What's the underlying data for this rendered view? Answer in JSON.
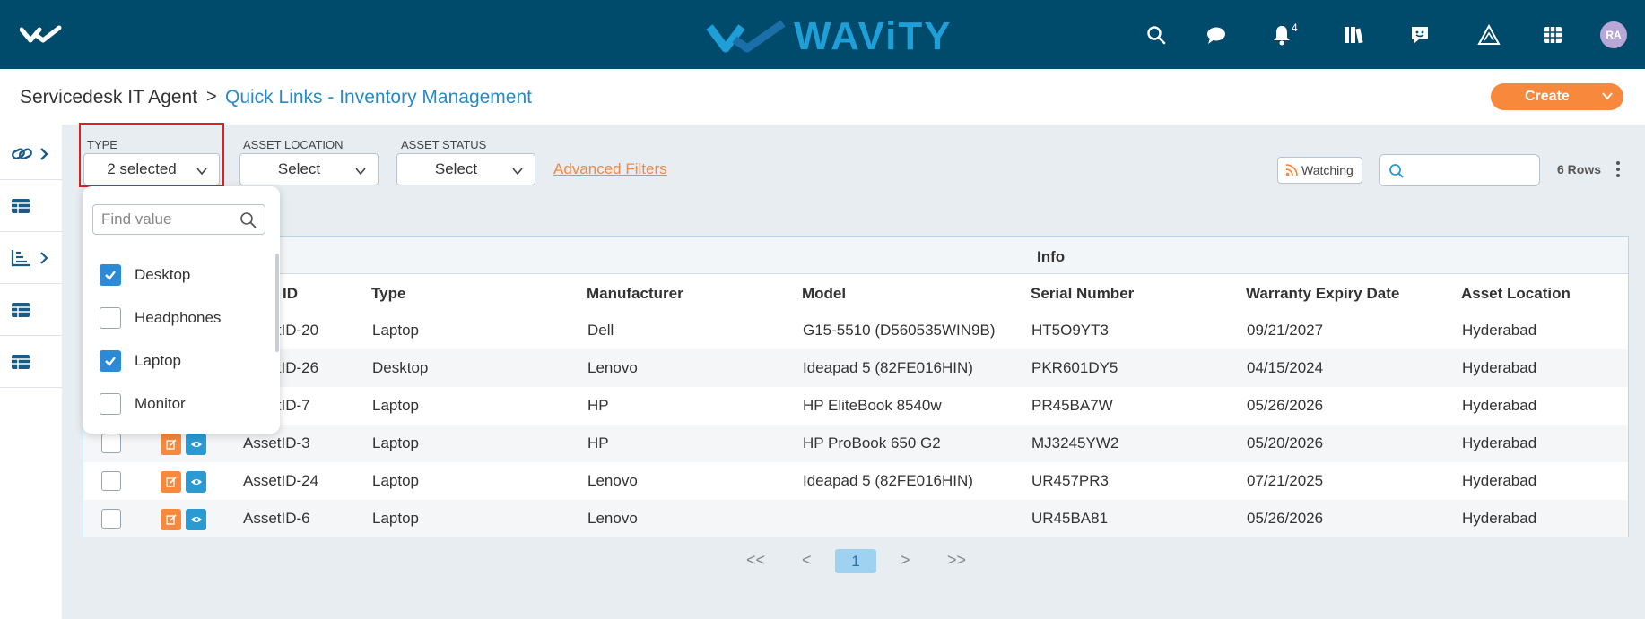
{
  "topbar": {
    "brand": "WAViTY",
    "notification_count": "4",
    "avatar_initials": "RA",
    "icons": [
      "search-icon",
      "chat-icon",
      "bell-icon",
      "library-icon",
      "feedback-icon",
      "alert-triangle-icon",
      "grid-icon"
    ]
  },
  "breadcrumb": {
    "root": "Servicedesk IT Agent",
    "separator": ">",
    "current": "Quick Links - Inventory Management"
  },
  "create_button": "Create",
  "filters": {
    "type": {
      "label": "TYPE",
      "value": "2 selected"
    },
    "asset_location": {
      "label": "ASSET LOCATION",
      "value": "Select"
    },
    "asset_status": {
      "label": "ASSET STATUS",
      "value": "Select"
    },
    "advanced_link": "Advanced Filters"
  },
  "toolbar": {
    "watching": "Watching",
    "search_placeholder": "",
    "rows_count": "6 Rows"
  },
  "type_dropdown": {
    "search_placeholder": "Find value",
    "options": [
      {
        "label": "Desktop",
        "checked": true
      },
      {
        "label": "Headphones",
        "checked": false
      },
      {
        "label": "Laptop",
        "checked": true
      },
      {
        "label": "Monitor",
        "checked": false
      }
    ]
  },
  "table": {
    "group_header": "Info",
    "columns": [
      "ID",
      "Type",
      "Manufacturer",
      "Model",
      "Serial Number",
      "Warranty Expiry Date",
      "Asset Location"
    ],
    "rows": [
      {
        "id": "AssetID-20",
        "type": "Laptop",
        "manufacturer": "Dell",
        "model": "G15-5510 (D560535WIN9B)",
        "serial": "HT5O9YT3",
        "warranty": "09/21/2027",
        "location": "Hyderabad"
      },
      {
        "id": "AssetID-26",
        "type": "Desktop",
        "manufacturer": "Lenovo",
        "model": "Ideapad 5 (82FE016HIN)",
        "serial": "PKR601DY5",
        "warranty": "04/15/2024",
        "location": "Hyderabad"
      },
      {
        "id": "AssetID-7",
        "type": "Laptop",
        "manufacturer": "HP",
        "model": "HP EliteBook 8540w",
        "serial": "PR45BA7W",
        "warranty": "05/26/2026",
        "location": "Hyderabad"
      },
      {
        "id": "AssetID-3",
        "type": "Laptop",
        "manufacturer": "HP",
        "model": "HP ProBook 650 G2",
        "serial": "MJ3245YW2",
        "warranty": "05/20/2026",
        "location": "Hyderabad"
      },
      {
        "id": "AssetID-24",
        "type": "Laptop",
        "manufacturer": "Lenovo",
        "model": "Ideapad 5 (82FE016HIN)",
        "serial": "UR457PR3",
        "warranty": "07/21/2025",
        "location": "Hyderabad"
      },
      {
        "id": "AssetID-6",
        "type": "Laptop",
        "manufacturer": "Lenovo",
        "model": "",
        "serial": "UR45BA81",
        "warranty": "05/26/2026",
        "location": "Hyderabad"
      }
    ]
  },
  "pagination": {
    "first": "<<",
    "prev": "<",
    "current": "1",
    "next": ">",
    "last": ">>"
  },
  "colors": {
    "topbar": "#004a6b",
    "brand": "#1e9fd8",
    "accent_orange": "#f7883c",
    "link_blue": "#2a8ac4",
    "checkbox_blue": "#2a8ad8",
    "highlight_red": "#e02020"
  }
}
